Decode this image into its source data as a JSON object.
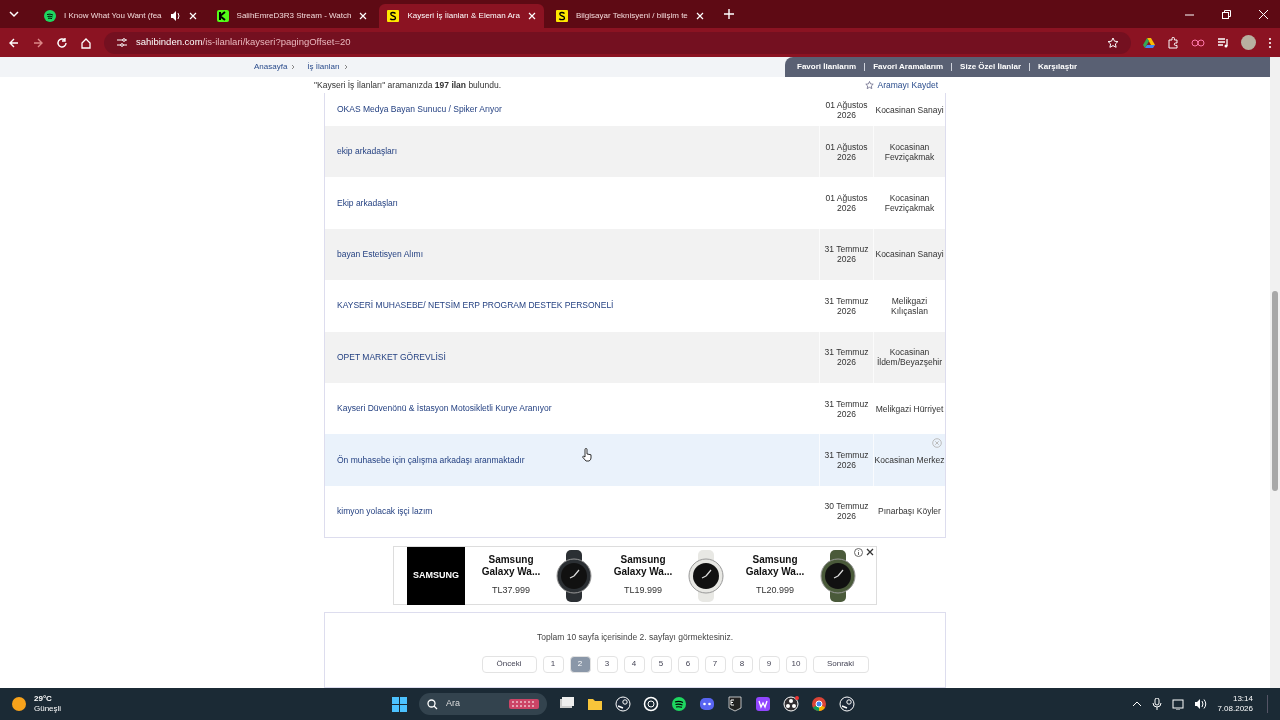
{
  "browser": {
    "tabs": [
      {
        "title": "I Know What You Want (fea",
        "kind": "spotify",
        "audio": true,
        "selected": false
      },
      {
        "title": "SalihEmreD3R3 Stream - Watch",
        "kind": "kick",
        "audio": false,
        "selected": false
      },
      {
        "title": "Kayseri İş İlanları & Eleman Ara",
        "kind": "sahibinden",
        "audio": false,
        "selected": true
      },
      {
        "title": "Bilgisayar Teknisyeni / bilişim te",
        "kind": "sahibinden",
        "audio": false,
        "selected": false
      }
    ],
    "url_host": "sahibinden.com",
    "url_path": "/is-ilanlari/kayseri?pagingOffset=20"
  },
  "breadcrumb": [
    "Anasayfa",
    "İş İlanları"
  ],
  "user_links": [
    "Favori İlanlarım",
    "Favori Aramalarım",
    "Size Özel İlanlar",
    "Karşılaştır"
  ],
  "results": {
    "text": "\"Kayseri İş İlanları\" aramanızda **197 ilan** bulundu.",
    "save_search": "Aramayı Kaydet"
  },
  "listings": [
    {
      "title": "OKAS Medya Bayan Sunucu / Spiker Arıyor",
      "date": "01 Ağustos 2026",
      "location": "Kocasinan Sanayi",
      "hovered": false
    },
    {
      "title": "ekip arkadaşları",
      "date": "01 Ağustos 2026",
      "location": "Kocasinan Fevziçakmak",
      "hovered": false
    },
    {
      "title": "Ekip arkadaşları",
      "date": "01 Ağustos 2026",
      "location": "Kocasinan Fevziçakmak",
      "hovered": false
    },
    {
      "title": "bayan Estetisyen Alımı",
      "date": "31 Temmuz 2026",
      "location": "Kocasinan Sanayi",
      "hovered": false
    },
    {
      "title": "KAYSERİ MUHASEBE/ NETSİM ERP PROGRAM DESTEK PERSONELİ",
      "date": "31 Temmuz 2026",
      "location": "Melikgazi Kılıçaslan",
      "hovered": false
    },
    {
      "title": "OPET MARKET GÖREVLİSİ",
      "date": "31 Temmuz 2026",
      "location": "Kocasinan İldem/Beyazşehir",
      "hovered": false
    },
    {
      "title": "Kayseri Düvenönü & İstasyon Motosikletli Kurye Aranıyor",
      "date": "31 Temmuz 2026",
      "location": "Melikgazi Hürriyet",
      "hovered": false
    },
    {
      "title": "Ön muhasebe için çalışma arkadaşı aranmaktadır",
      "date": "31 Temmuz 2026",
      "location": "Kocasinan Merkez",
      "hovered": true
    },
    {
      "title": "kimyon yolacak işçi lazım",
      "date": "30 Temmuz 2026",
      "location": "Pınarbaşı Köyler",
      "hovered": false
    }
  ],
  "ad": {
    "brand": "SAMSUNG",
    "products": [
      {
        "name": "Samsung Galaxy Wa...",
        "price": "TL37.999",
        "color": "#2b2f33"
      },
      {
        "name": "Samsung Galaxy Wa...",
        "price": "TL19.999",
        "color": "#e8e8e4"
      },
      {
        "name": "Samsung Galaxy Wa...",
        "price": "TL20.999",
        "color": "#4a5a3a"
      }
    ]
  },
  "pagination": {
    "summary": "Toplam 10 sayfa içerisinde 2. sayfayı görmektesiniz.",
    "previous": "Önceki",
    "next": "Sonraki",
    "pages": [
      {
        "label": "1",
        "selected": false
      },
      {
        "label": "2",
        "selected": true
      },
      {
        "label": "3",
        "selected": false
      },
      {
        "label": "4",
        "selected": false
      },
      {
        "label": "5",
        "selected": false
      },
      {
        "label": "6",
        "selected": false
      },
      {
        "label": "7",
        "selected": false
      },
      {
        "label": "8",
        "selected": false
      },
      {
        "label": "9",
        "selected": false
      },
      {
        "label": "10",
        "selected": false
      }
    ]
  },
  "taskbar": {
    "temperature": "29°C",
    "weather": "Güneşli",
    "search": "Ara",
    "time": "13:14",
    "date": "7.08.2026"
  }
}
